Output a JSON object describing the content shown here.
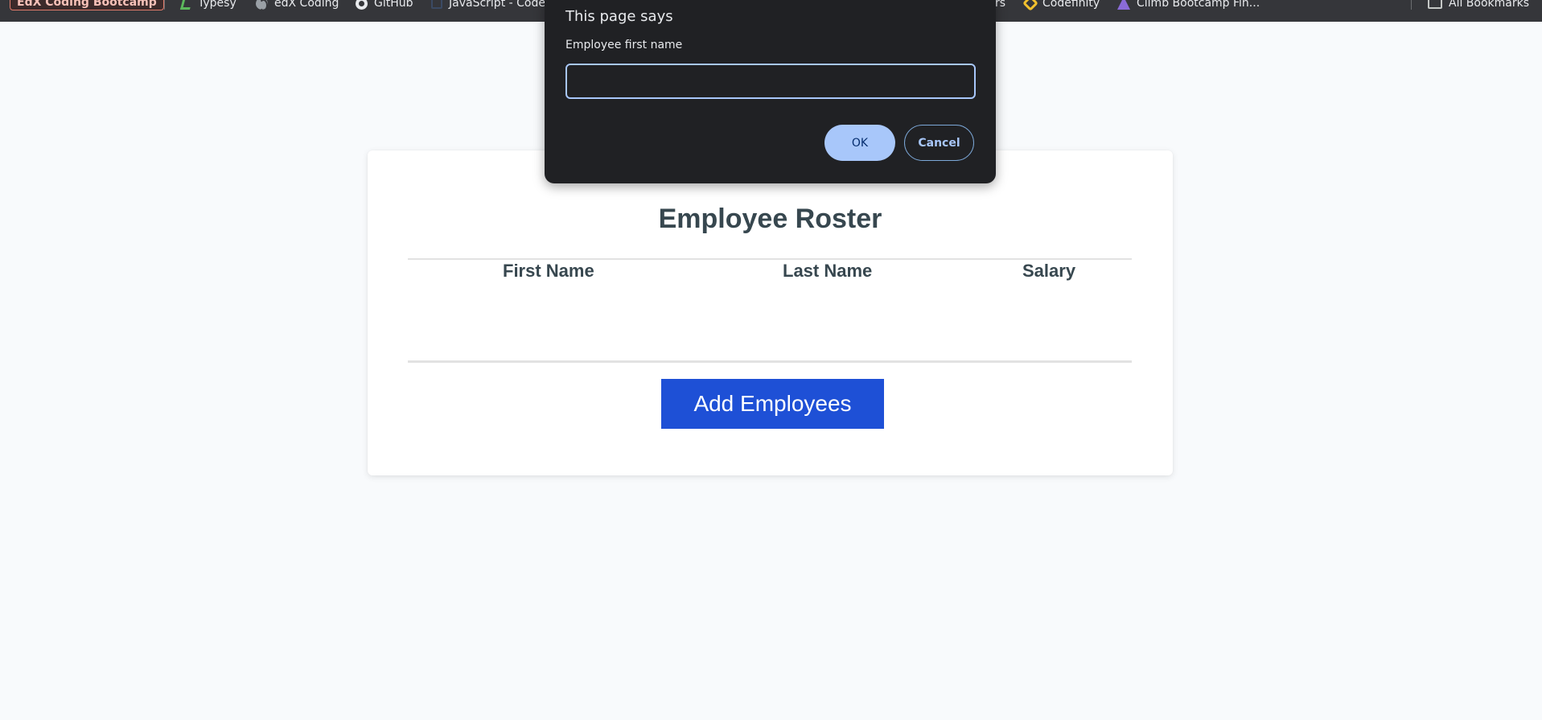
{
  "bookmarks": {
    "folder_tag": "EdX Coding Bootcamp",
    "items": [
      {
        "label": "Typesy",
        "icon": "typesy-icon"
      },
      {
        "label": "edX Coding",
        "icon": "globe-icon"
      },
      {
        "label": "GitHub",
        "icon": "github-icon"
      },
      {
        "label": "JavaScript - Code",
        "icon": "javascript-icon"
      },
      {
        "label": "rs",
        "icon": ""
      },
      {
        "label": "Codefinity",
        "icon": "codefinity-icon"
      },
      {
        "label": "Climb Bootcamp Fin...",
        "icon": "climb-icon"
      }
    ],
    "all_bookmarks": "All Bookmarks"
  },
  "dialog": {
    "title": "This page says",
    "label": "Employee first name",
    "input_value": "",
    "ok_label": "OK",
    "cancel_label": "Cancel"
  },
  "roster": {
    "title": "Employee Roster",
    "columns": [
      "First Name",
      "Last Name",
      "Salary"
    ],
    "rows": [],
    "add_button_label": "Add Employees"
  },
  "colors": {
    "accent": "#1e50d6",
    "dialog_bg": "#202124",
    "dialog_accent": "#a8c7fa"
  }
}
